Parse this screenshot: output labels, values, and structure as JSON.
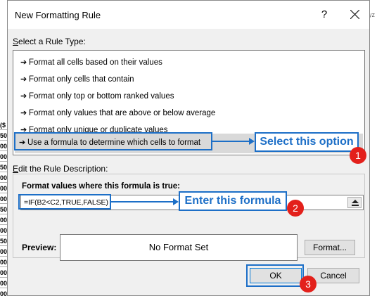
{
  "dialog": {
    "title": "New Formatting Rule",
    "help_glyph": "?",
    "close_icon": "close-icon"
  },
  "rule_type": {
    "label_prefix": "",
    "label_underline": "S",
    "label_rest": "elect a Rule Type:",
    "arrow_glyph": "→",
    "items": [
      {
        "label": "Format all cells based on their values"
      },
      {
        "label": "Format only cells that contain"
      },
      {
        "label": "Format only top or bottom ranked values"
      },
      {
        "label": "Format only values that are above or below average"
      },
      {
        "label": "Format only unique or duplicate values"
      },
      {
        "label": "Use a formula to determine which cells to format",
        "selected": true
      }
    ]
  },
  "description": {
    "label_underline": "E",
    "label_rest": "dit the Rule Description:",
    "formula_label_underline": "O",
    "formula_label_prefix": "F",
    "formula_label": "Format values where this formula is true:",
    "formula_value": "=IF(B2<C2,TRUE,FALSE)",
    "preview_label": "Preview:",
    "preview_text": "No Format Set",
    "format_button": "Format..."
  },
  "buttons": {
    "ok": "OK",
    "cancel": "Cancel"
  },
  "annotations": {
    "step1_text": "Select this option",
    "step1_num": "1",
    "step2_text": "Enter this formula",
    "step2_num": "2",
    "step3_num": "3",
    "color": "#1d6fc7",
    "badge_color": "#e3201b"
  },
  "background": {
    "left_cells": [
      "($",
      "50",
      "00",
      "00",
      "50",
      "00",
      "00",
      "00",
      "50",
      "00",
      "00",
      "50",
      "00",
      "00",
      "00",
      "00",
      "00"
    ],
    "right_text": "yz"
  }
}
